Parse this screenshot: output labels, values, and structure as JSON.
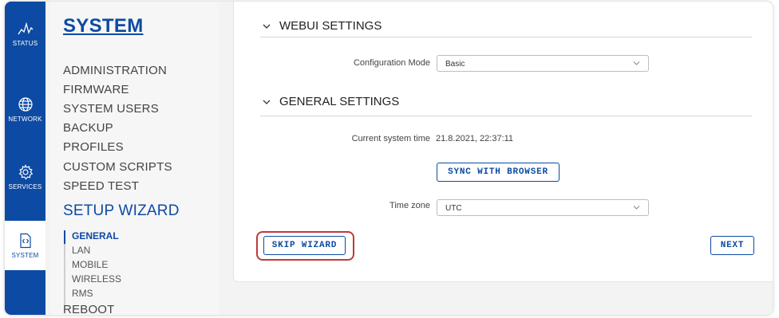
{
  "rail": {
    "items": [
      {
        "label": "STATUS",
        "icon": "status-icon"
      },
      {
        "label": "NETWORK",
        "icon": "globe-icon"
      },
      {
        "label": "SERVICES",
        "icon": "gear-icon"
      },
      {
        "label": "SYSTEM",
        "icon": "code-icon"
      }
    ],
    "active": "SYSTEM"
  },
  "nav": {
    "title": "SYSTEM",
    "items": [
      "ADMINISTRATION",
      "FIRMWARE",
      "SYSTEM USERS",
      "BACKUP",
      "PROFILES",
      "CUSTOM SCRIPTS",
      "SPEED TEST"
    ],
    "current": "SETUP WIZARD",
    "sub_items": [
      "GENERAL",
      "LAN",
      "MOBILE",
      "WIRELESS",
      "RMS"
    ],
    "after": "REBOOT"
  },
  "webui": {
    "heading": "WEBUI SETTINGS",
    "config_mode_label": "Configuration Mode",
    "config_mode_value": "Basic"
  },
  "general": {
    "heading": "GENERAL SETTINGS",
    "time_label": "Current system time",
    "time_value": "21.8.2021, 22:37:11",
    "sync_button": "SYNC WITH BROWSER",
    "timezone_label": "Time zone",
    "timezone_value": "UTC"
  },
  "actions": {
    "skip": "SKIP WIZARD",
    "next": "NEXT"
  },
  "colors": {
    "brand": "#0d4aa3",
    "highlight": "#c0393b"
  }
}
